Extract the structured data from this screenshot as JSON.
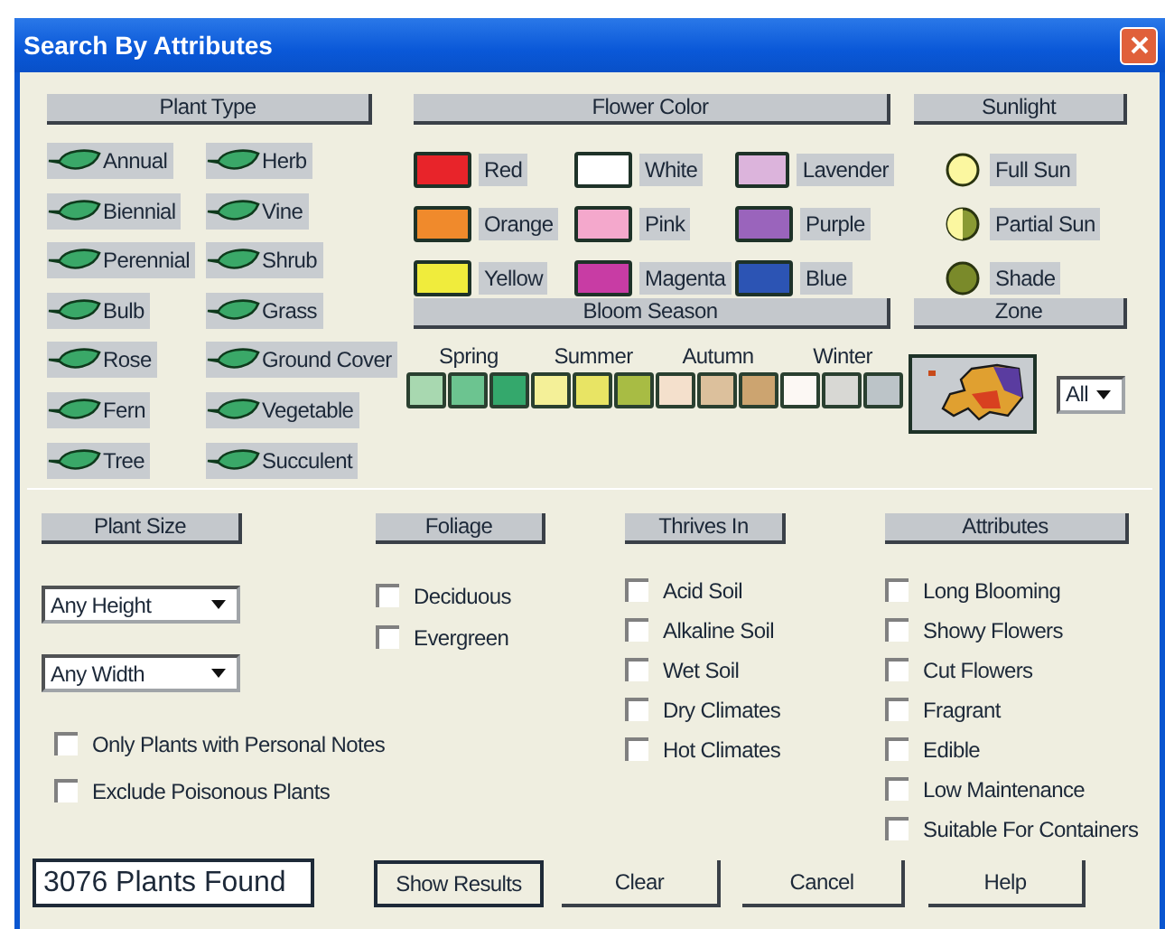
{
  "window": {
    "title": "Search By Attributes"
  },
  "plant_type": {
    "header": "Plant Type",
    "items": [
      {
        "label": "Annual"
      },
      {
        "label": "Herb"
      },
      {
        "label": "Biennial"
      },
      {
        "label": "Vine"
      },
      {
        "label": "Perennial"
      },
      {
        "label": "Shrub"
      },
      {
        "label": "Bulb"
      },
      {
        "label": "Grass"
      },
      {
        "label": "Rose"
      },
      {
        "label": "Ground Cover"
      },
      {
        "label": "Fern"
      },
      {
        "label": "Vegetable"
      },
      {
        "label": "Tree"
      },
      {
        "label": "Succulent"
      }
    ]
  },
  "flower_color": {
    "header": "Flower Color",
    "items": [
      {
        "label": "Red",
        "color": "#e8242a"
      },
      {
        "label": "White",
        "color": "#ffffff"
      },
      {
        "label": "Lavender",
        "color": "#dcb4dc"
      },
      {
        "label": "Orange",
        "color": "#f08a2c"
      },
      {
        "label": "Pink",
        "color": "#f4a8cc"
      },
      {
        "label": "Purple",
        "color": "#9a64bc"
      },
      {
        "label": "Yellow",
        "color": "#f0ec3c"
      },
      {
        "label": "Magenta",
        "color": "#c83ca4"
      },
      {
        "label": "Blue",
        "color": "#2c54b4"
      }
    ]
  },
  "sunlight": {
    "header": "Sunlight",
    "items": [
      {
        "label": "Full Sun",
        "kind": "full"
      },
      {
        "label": "Partial Sun",
        "kind": "partial"
      },
      {
        "label": "Shade",
        "kind": "shade"
      }
    ]
  },
  "bloom_season": {
    "header": "Bloom Season",
    "seasons": [
      {
        "label": "Spring",
        "swatches": [
          {
            "color": "#a8d8b0"
          },
          {
            "color": "#6cc490"
          },
          {
            "color": "#34a86c"
          }
        ]
      },
      {
        "label": "Summer",
        "swatches": [
          {
            "color": "#f4f098"
          },
          {
            "color": "#e8e464"
          },
          {
            "color": "#a8bc44"
          }
        ]
      },
      {
        "label": "Autumn",
        "swatches": [
          {
            "color": "#f4e0cc"
          },
          {
            "color": "#dcc09c"
          },
          {
            "color": "#cca470"
          }
        ]
      },
      {
        "label": "Winter",
        "swatches": [
          {
            "color": "#fcf8f4"
          },
          {
            "color": "#d8d8d4"
          },
          {
            "color": "#bcc4c8"
          }
        ]
      }
    ]
  },
  "zone": {
    "header": "Zone",
    "value": "All"
  },
  "plant_size": {
    "header": "Plant Size",
    "height": "Any Height",
    "width": "Any Width"
  },
  "foliage": {
    "header": "Foliage",
    "items": [
      {
        "label": "Deciduous",
        "checked": false
      },
      {
        "label": "Evergreen",
        "checked": false
      }
    ]
  },
  "thrives_in": {
    "header": "Thrives In",
    "items": [
      {
        "label": "Acid Soil",
        "checked": false
      },
      {
        "label": "Alkaline Soil",
        "checked": false
      },
      {
        "label": "Wet Soil",
        "checked": false
      },
      {
        "label": "Dry Climates",
        "checked": false
      },
      {
        "label": "Hot Climates",
        "checked": false
      }
    ]
  },
  "attributes": {
    "header": "Attributes",
    "items": [
      {
        "label": "Long Blooming",
        "checked": false
      },
      {
        "label": "Showy Flowers",
        "checked": false
      },
      {
        "label": "Cut Flowers",
        "checked": false
      },
      {
        "label": "Fragrant",
        "checked": false
      },
      {
        "label": "Edible",
        "checked": false
      },
      {
        "label": "Low Maintenance",
        "checked": false
      },
      {
        "label": "Suitable For Containers",
        "checked": false
      }
    ]
  },
  "options": [
    {
      "label": "Only Plants with Personal Notes",
      "checked": false
    },
    {
      "label": "Exclude Poisonous Plants",
      "checked": false
    }
  ],
  "result_count": "3076 Plants Found",
  "buttons": [
    "Show Results",
    "Clear",
    "Cancel",
    "Help"
  ]
}
